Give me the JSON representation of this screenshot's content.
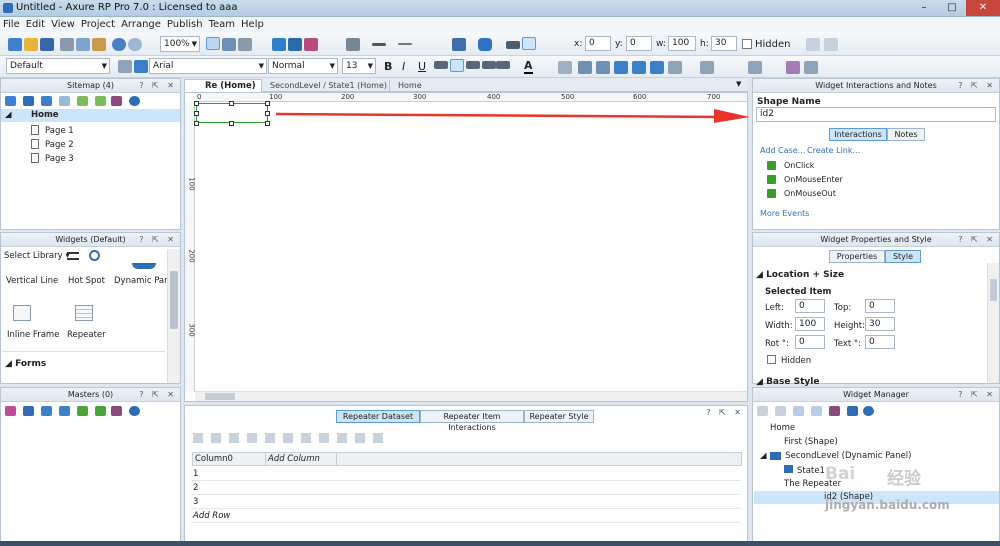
{
  "window": {
    "title": "Untitled - Axure RP Pro 7.0 : Licensed to aaa",
    "minimize": "–",
    "maximize": "□",
    "close": "✕"
  },
  "menu": [
    "File",
    "Edit",
    "View",
    "Project",
    "Arrange",
    "Publish",
    "Team",
    "Help"
  ],
  "toolbar": {
    "zoom": "100%",
    "x_label": "x:",
    "x": "0",
    "y_label": "y:",
    "y": "0",
    "w_label": "w:",
    "w": "100",
    "h_label": "h:",
    "h": "30",
    "hidden_label": "Hidden"
  },
  "format": {
    "style": "Default",
    "font": "Arial",
    "weight": "Normal",
    "size": "13",
    "bold": "B",
    "italic": "I",
    "underline": "U",
    "font_color": "A"
  },
  "sitemap": {
    "title": "Sitemap (4)",
    "home": "Home",
    "pages": [
      "Page 1",
      "Page 2",
      "Page 3"
    ]
  },
  "widgets": {
    "title": "Widgets (Default)",
    "library": "Select Library",
    "items": [
      "Vertical Line",
      "Hot Spot",
      "Dynamic Panel",
      "Inline Frame",
      "Repeater"
    ],
    "section": "Forms"
  },
  "masters": {
    "title": "Masters (0)"
  },
  "tabs": [
    "Re (Home)",
    "SecondLevel / State1 (Home)",
    "Home"
  ],
  "ruler": {
    "h": [
      "0",
      "100",
      "200",
      "300",
      "400",
      "500",
      "600",
      "700"
    ],
    "v": [
      "100",
      "200",
      "300"
    ]
  },
  "bottom": {
    "tabs": [
      "Repeater Dataset",
      "Repeater Item Interactions",
      "Repeater Style"
    ],
    "columns": [
      "Column0",
      "Add Column"
    ],
    "rows": [
      "1",
      "2",
      "3"
    ],
    "add_row": "Add Row"
  },
  "interactions": {
    "title": "Widget Interactions and Notes",
    "shape_name_label": "Shape Name",
    "shape_name": "id2",
    "tabs": [
      "Interactions",
      "Notes"
    ],
    "add_case": "Add Case...",
    "create_link": "Create Link...",
    "events": [
      "OnClick",
      "OnMouseEnter",
      "OnMouseOut"
    ],
    "more_events": "More Events"
  },
  "properties": {
    "title": "Widget Properties and Style",
    "tabs": [
      "Properties",
      "Style"
    ],
    "section": "Location + Size",
    "selected": "Selected Item",
    "left_label": "Left:",
    "left": "0",
    "top_label": "Top:",
    "top": "0",
    "width_label": "Width:",
    "width": "100",
    "height_label": "Height:",
    "height": "30",
    "rot_label": "Rot °:",
    "rot": "0",
    "text_label": "Text °:",
    "text": "0",
    "hidden_label": "Hidden",
    "base_style": "Base Style"
  },
  "manager": {
    "title": "Widget Manager",
    "tree": [
      "Home",
      "First (Shape)",
      "SecondLevel (Dynamic Panel)",
      "State1",
      "The Repeater",
      "id2 (Shape)"
    ]
  },
  "watermark": {
    "brand": "Bai",
    "cn": "经验",
    "url": "jingyan.baidu.com"
  },
  "colors": {
    "accent": "#cde5fb",
    "arrow": "#e8342a",
    "selection": "#2a9d2a"
  }
}
